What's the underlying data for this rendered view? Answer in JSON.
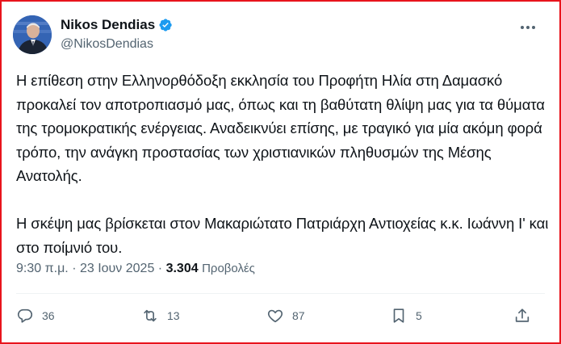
{
  "author": {
    "name": "Nikos Dendias",
    "handle": "@NikosDendias"
  },
  "tweet": {
    "paragraphs": [
      "Η επίθεση στην Ελληνορθόδοξη εκκλησία του Προφήτη Ηλία στη Δαμασκό προκαλεί τον αποτροπιασμό μας, όπως και τη βαθύτατη θλίψη μας για τα θύματα της τρομοκρατικής ενέργειας. Αναδεικνύει επίσης, με τραγικό για μία ακόμη φορά τρόπο, την ανάγκη προστασίας των χριστιανικών πληθυσμών της Μέσης Ανατολής.",
      "Η σκέψη μας βρίσκεται στον Μακαριώτατο Πατριάρχη Αντιοχείας κ.κ. Ιωάννη Ι' και στο ποίμνιό του."
    ],
    "time": "9:30 π.μ.",
    "separator": "·",
    "date": "23 Ιουν 2025",
    "views_count": "3.304",
    "views_label": "Προβολές"
  },
  "actions": {
    "replies": "36",
    "reposts": "13",
    "likes": "87",
    "bookmarks": "5"
  },
  "colors": {
    "frame_border": "#e8141c",
    "verified_badge": "#1d9bf0",
    "text_primary": "#0f1419",
    "text_secondary": "#536471"
  },
  "icons": [
    "verified-badge-icon",
    "more-options-icon",
    "reply-icon",
    "repost-icon",
    "like-icon",
    "bookmark-icon",
    "share-icon"
  ]
}
